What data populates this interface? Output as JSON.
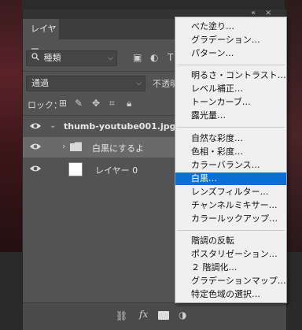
{
  "panel": {
    "tab_label": "レイヤー",
    "topbar_collapse": "«",
    "topbar_close": "×",
    "filter_kind": "種類",
    "blend_mode": "通過",
    "opacity_label": "不透明",
    "lock_label": "ロック："
  },
  "layers": [
    {
      "name": "thumb-youtube001.jpg"
    },
    {
      "name": "白黒にするよ"
    },
    {
      "name": "レイヤー 0"
    }
  ],
  "bottom_icons": [
    "link-icon",
    "fx-icon",
    "mask-icon",
    "adjustment-icon",
    "folder-icon",
    "new-layer-icon",
    "trash-icon"
  ],
  "bottom_fx_label": "fx",
  "menu": {
    "items": [
      "べた塗り…",
      "グラデーション…",
      "パターン…",
      "明るさ・コントラスト…",
      "レベル補正…",
      "トーンカーブ…",
      "露光量…",
      "自然な彩度…",
      "色相・彩度…",
      "カラーバランス…",
      "白黒…",
      "レンズフィルター…",
      "チャンネルミキサー…",
      "カラールックアップ…",
      "階調の反転",
      "ポスタリゼーション…",
      "２ 階調化…",
      "グラデーションマップ…",
      "特定色域の選択…"
    ],
    "highlighted": "白黒…"
  },
  "colors": {
    "highlight": "#0b6fd8",
    "panel_bg": "#535353",
    "menu_bg": "#f0f0f0"
  }
}
